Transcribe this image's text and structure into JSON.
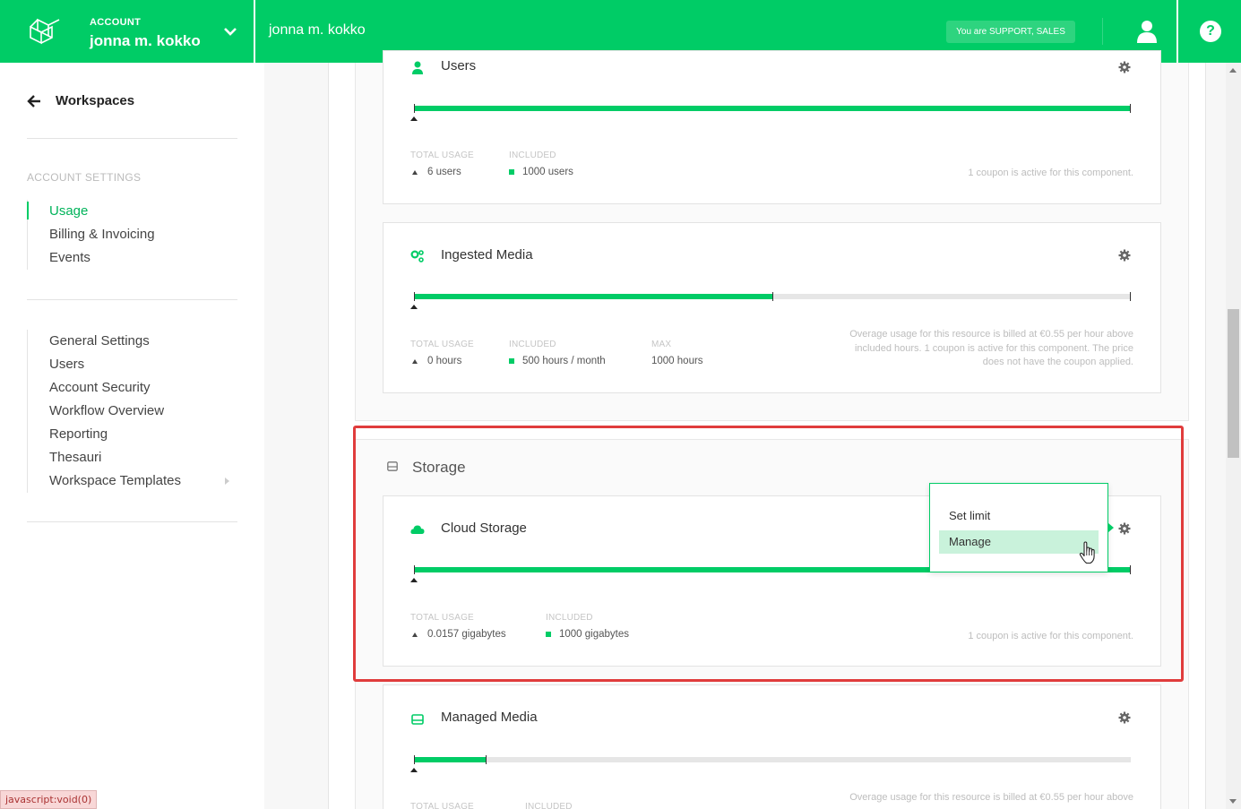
{
  "topbar": {
    "account_label": "ACCOUNT",
    "account_name": "jonna m. kokko",
    "page_title": "jonna m. kokko",
    "role_badge": "You are SUPPORT, SALES",
    "help_glyph": "?"
  },
  "sidebar": {
    "back_label": "Workspaces",
    "section_label": "ACCOUNT SETTINGS",
    "group1": [
      "Usage",
      "Billing & Invoicing",
      "Events"
    ],
    "group2": [
      "General Settings",
      "Users",
      "Account Security",
      "Workflow Overview",
      "Reporting",
      "Thesauri",
      "Workspace Templates"
    ],
    "active_item": "Usage"
  },
  "cards": {
    "users": {
      "title": "Users",
      "fill_fraction": 1.0,
      "total_usage_label": "TOTAL USAGE",
      "total_usage_value": "6 users",
      "included_label": "INCLUDED",
      "included_value": "1000 users",
      "note": "1 coupon is active for this component."
    },
    "ingested": {
      "title": "Ingested Media",
      "fill_fraction": 0.5,
      "total_usage_label": "TOTAL USAGE",
      "total_usage_value": "0 hours",
      "included_label": "INCLUDED",
      "included_value": "500 hours / month",
      "max_label": "MAX",
      "max_value": "1000 hours",
      "note_l1": "Overage usage for this resource is billed at €0.55 per hour above",
      "note_l2": "included hours. 1 coupon is active for this component. The price",
      "note_l3": "does not have the coupon applied."
    },
    "storage_section_title": "Storage",
    "cloud": {
      "title": "Cloud Storage",
      "fill_fraction": 1.0,
      "total_usage_label": "TOTAL USAGE",
      "total_usage_value": "0.0157 gigabytes",
      "included_label": "INCLUDED",
      "included_value": "1000 gigabytes",
      "note": "1 coupon is active for this component."
    },
    "managed": {
      "title": "Managed Media",
      "fill_fraction": 0.1,
      "total_usage_label": "TOTAL USAGE",
      "included_label": "INCLUDED",
      "note_l1": "Overage usage for this resource is billed at €0.55 per hour above"
    }
  },
  "dropdown": {
    "items": [
      "Set limit",
      "Manage"
    ],
    "hovered": "Manage"
  },
  "status_bar": "javascript:void(0)",
  "colors": {
    "brand": "#00cc66",
    "highlight": "#e03c3c",
    "hover": "#c9f2db"
  }
}
